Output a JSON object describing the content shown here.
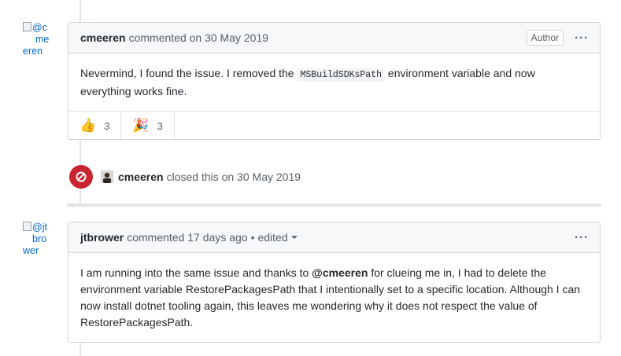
{
  "comments": [
    {
      "avatar_alt": [
        "@c",
        "me",
        "eren"
      ],
      "author": "cmeeren",
      "meta": "commented on 30 May 2019",
      "badge": "Author",
      "menu": "···",
      "body_before": "Nevermind, I found the issue. I removed the",
      "code": "MSBuildSDKsPath",
      "body_after": "environment variable and now everything works fine.",
      "reactions": [
        {
          "emoji": "👍",
          "icon": "thumbs-up-icon",
          "count": "3"
        },
        {
          "emoji": "🎉",
          "icon": "tada-icon",
          "count": "3"
        }
      ]
    },
    {
      "avatar_alt": [
        "@jt",
        "bro",
        "wer"
      ],
      "author": "jtbrower",
      "meta": "commented 17 days ago",
      "sep": "•",
      "edited": "edited",
      "menu": "···",
      "body_before": "I am running into the same issue and thanks to",
      "mention": "@cmeeren",
      "body_after": "for clueing me in, I had to delete the environment variable RestorePackagesPath that I intentionally set to a specific location. Although I can now install dotnet tooling again, this leaves me wondering why it does not respect the value of RestorePackagesPath."
    }
  ],
  "event": {
    "icon": "closed-circle-slash-icon",
    "author": "cmeeren",
    "text": "closed this on 30 May 2019"
  },
  "colors": {
    "closed": "#cb2431",
    "link": "#0366d6",
    "border": "#d1d5da",
    "header_bg": "#f6f8fa"
  }
}
